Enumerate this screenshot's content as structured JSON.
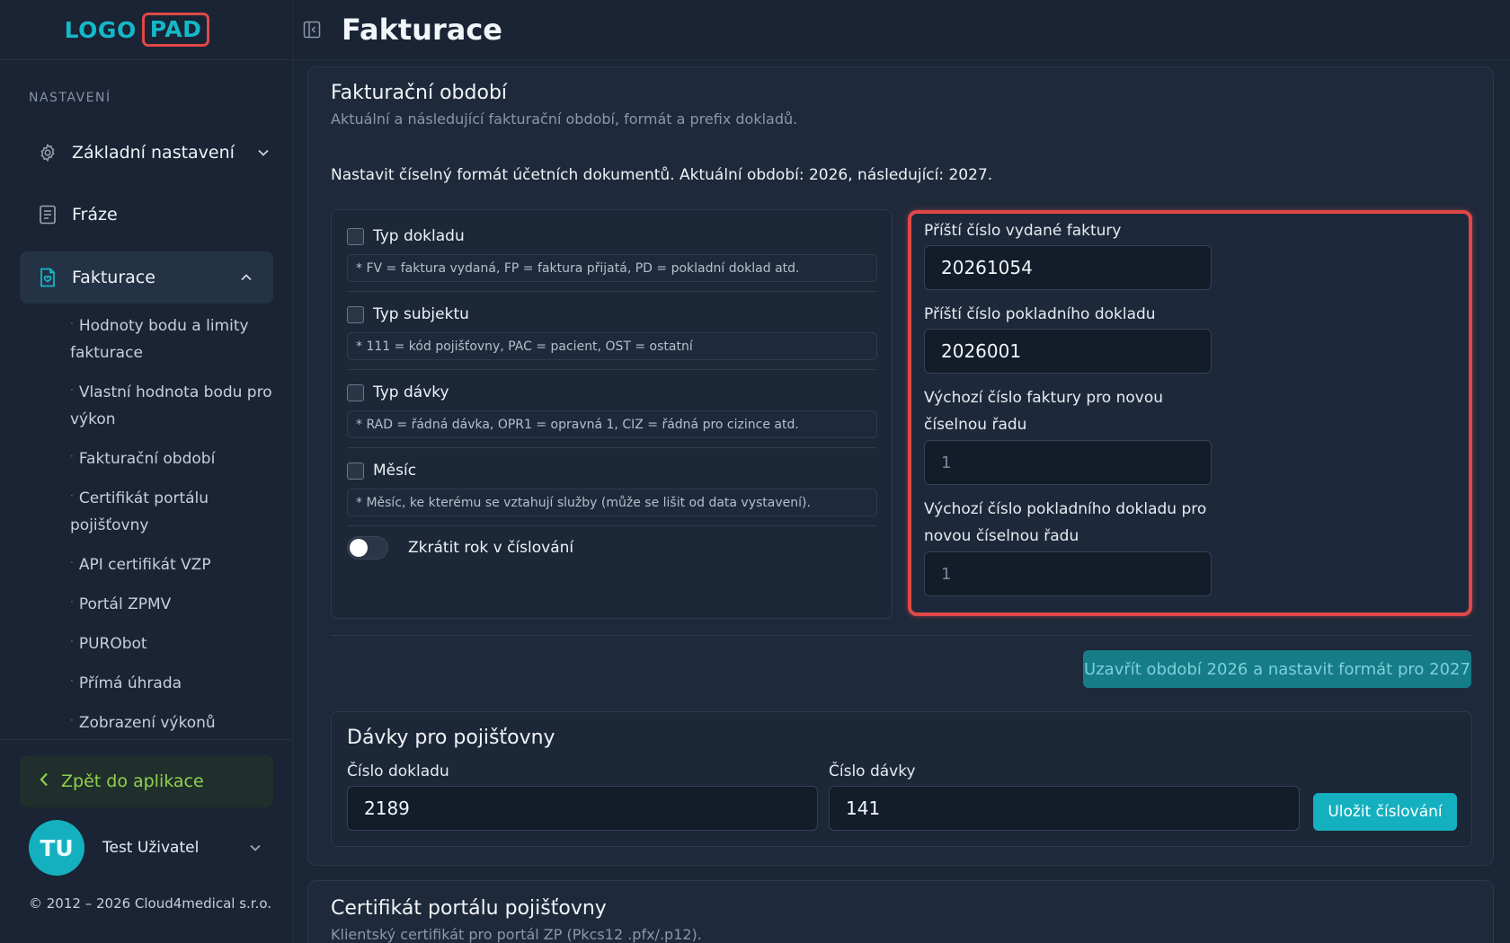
{
  "logo": {
    "word": "LOGO",
    "pad": "PAD"
  },
  "sidebar": {
    "section_label": "NASTAVENÍ",
    "items": [
      {
        "label": "Základní nastavení",
        "icon": "gear-icon"
      },
      {
        "label": "Fráze",
        "icon": "document-icon"
      },
      {
        "label": "Fakturace",
        "icon": "invoice-icon"
      }
    ],
    "sub_items": [
      "Hodnoty bodu a limity fakturace",
      "Vlastní hodnota bodu pro výkon",
      "Fakturační období",
      "Certifikát portálu pojišťovny",
      "API certifikát VZP",
      "Portál ZPMV",
      "PURObot",
      "Přímá úhrada",
      "Zobrazení výkonů"
    ],
    "back_label": "Zpět do aplikace",
    "user": {
      "initials": "TU",
      "name": "Test Uživatel"
    },
    "copyright": "© 2012 – 2026 Cloud4medical s.r.o."
  },
  "header": {
    "title": "Fakturace"
  },
  "period": {
    "title": "Fakturační období",
    "subtitle": "Aktuální a následující fakturační období, formát a prefix dokladů.",
    "format_note": "Nastavit číselný formát účetních dokumentů. Aktuální období: 2026, následující: 2027.",
    "options": [
      {
        "label": "Typ dokladu",
        "hint": "* FV = faktura vydaná, FP = faktura přijatá, PD = pokladní doklad atd.",
        "checked": false
      },
      {
        "label": "Typ subjektu",
        "hint": "* 111 = kód pojišťovny, PAC = pacient, OST = ostatní",
        "checked": false
      },
      {
        "label": "Typ dávky",
        "hint": "* RAD = řádná dávka, OPR1 = opravná 1, CIZ = řádná pro cizince atd.",
        "checked": false
      },
      {
        "label": "Měsíc",
        "hint": "* Měsíc, ke kterému se vztahují služby (může se lišit od data vystavení).",
        "checked": false
      }
    ],
    "toggle_label": "Zkrátit rok v číslování",
    "toggle_on": false,
    "fields": [
      {
        "label": "Příští číslo vydané faktury",
        "value": "20261054"
      },
      {
        "label": "Příští číslo pokladního dokladu",
        "value": "2026001"
      },
      {
        "label": "Výchozí číslo faktury pro novou číselnou řadu",
        "placeholder": "1"
      },
      {
        "label": "Výchozí číslo pokladního dokladu pro novou číselnou řadu",
        "placeholder": "1"
      }
    ],
    "close_button": "Uzavřít období 2026 a nastavit formát pro 2027"
  },
  "batches": {
    "title": "Dávky pro pojišťovny",
    "doc_label": "Číslo dokladu",
    "doc_value": "2189",
    "batch_label": "Číslo dávky",
    "batch_value": "141",
    "save_button": "Uložit číslování"
  },
  "certificate": {
    "title": "Certifikát portálu pojišťovny",
    "subtitle": "Klientský certifikát pro portál ZP (Pkcs12 .pfx/.p12)."
  },
  "colors": {
    "accent": "#14b0bf",
    "highlight": "#e04848",
    "back_green": "#8fd14f"
  }
}
